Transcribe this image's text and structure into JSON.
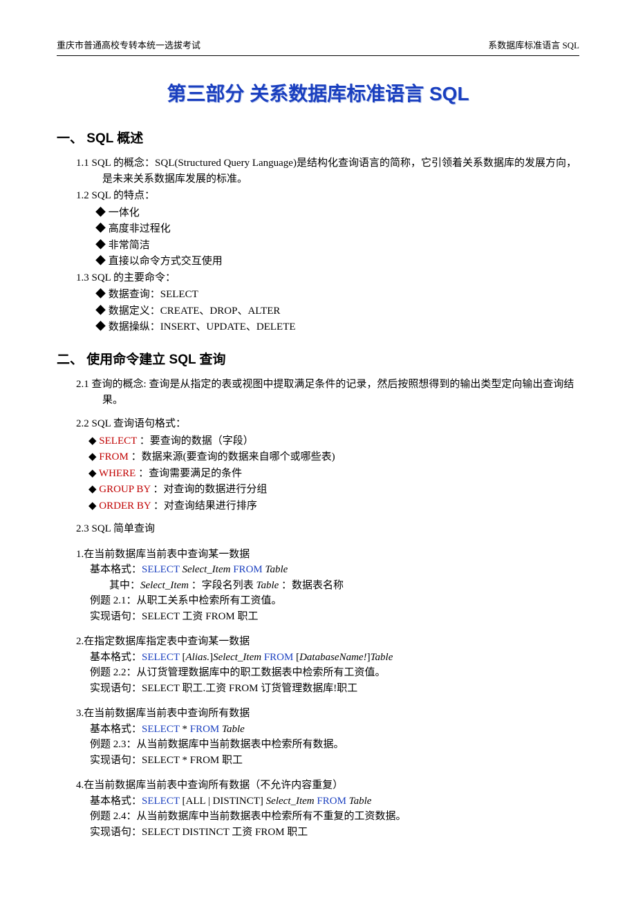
{
  "header": {
    "left": "重庆市普通高校专转本统一选拔考试",
    "right": "系数据库标准语言 SQL"
  },
  "title": "第三部分  关系数据库标准语言 SQL",
  "s1": {
    "heading": "一、 SQL 概述",
    "i1": {
      "num": "1.1",
      "text": " SQL 的概念：SQL(Structured Query Language)是结构化查询语言的简称，它引领着关系数据库的发展方向，是未来关系数据库发展的标准。"
    },
    "i2": {
      "num": "1.2",
      "text": " SQL 的特点：",
      "b": [
        "一体化",
        "高度非过程化",
        "非常简洁",
        "直接以命令方式交互使用"
      ]
    },
    "i3": {
      "num": "1.3",
      "text": " SQL 的主要命令：",
      "b": [
        "数据查询：SELECT",
        "数据定义：CREATE、DROP、ALTER",
        "数据操纵：INSERT、UPDATE、DELETE"
      ]
    }
  },
  "s2": {
    "heading": "二、 使用命令建立 SQL 查询",
    "i1": {
      "num": "2.1",
      "text": " 查询的概念: 查询是从指定的表或视图中提取满足条件的记录，然后按照想得到的输出类型定向输出查询结果。"
    },
    "i2": {
      "num": "2.2",
      "text": " SQL 查询语句格式：",
      "rows": [
        {
          "kw": "SELECT",
          "rest": " ：要查询的数据（字段）"
        },
        {
          "kw": "FROM",
          "rest": " ：数据来源(要查询的数据来自哪个或哪些表)"
        },
        {
          "kw": "WHERE",
          "rest": " ：查询需要满足的条件"
        },
        {
          "kw": "GROUP BY",
          "rest": " ：对查询的数据进行分组"
        },
        {
          "kw": "ORDER BY",
          "rest": " ：对查询结果进行排序"
        }
      ]
    },
    "i3": {
      "num": "2.3",
      "text": " SQL 简单查询",
      "q1": {
        "n": "1.在当前数据库当前表中查询某一数据",
        "fmt_lbl": "基本格式：",
        "fmt_sel": "SELECT",
        "fmt_it1": "Select_Item",
        "fmt_from": "FROM",
        "fmt_it2": "Table",
        "where": "其中：",
        "where_it1": "Select_Item",
        "where_t1": " ：字段名列表   ",
        "where_it2": "Table",
        "where_t2": " ：数据表名称",
        "ex": "例题 2.1：从职工关系中检索所有工资值。",
        "impl": "实现语句：SELECT 工资 FROM 职工"
      },
      "q2": {
        "n": "2.在指定数据库指定表中查询某一数据",
        "fmt_lbl": "基本格式：",
        "fmt_sel": "SELECT",
        "fmt_br1": " [",
        "fmt_it1": "Alias.",
        "fmt_br1b": "]",
        "fmt_it2": "Select_Item",
        "fmt_from": "FROM",
        "fmt_br2": " [",
        "fmt_it3": "DatabaseName!",
        "fmt_br2b": "]",
        "fmt_it4": "Table",
        "ex": "例题 2.2：从订货管理数据库中的职工数据表中检索所有工资值。",
        "impl": "实现语句：SELECT 职工.工资 FROM 订货管理数据库!职工"
      },
      "q3": {
        "n": "3.在当前数据库当前表中查询所有数据",
        "fmt_lbl": "基本格式：",
        "fmt_sel": "SELECT",
        "fmt_star": " *  ",
        "fmt_from": "FROM",
        "fmt_it": "Table",
        "ex": "例题 2.3：从当前数据库中当前数据表中检索所有数据。",
        "impl": "实现语句：SELECT * FROM 职工"
      },
      "q4": {
        "n": "4.在当前数据库当前表中查询所有数据（不允许内容重复）",
        "fmt_lbl": "基本格式：",
        "fmt_sel": "SELECT",
        "fmt_opt": " [ALL | DISTINCT] ",
        "fmt_it1": "Select_Item",
        "fmt_from": "FROM",
        "fmt_it2": "Table",
        "ex": "例题 2.4：从当前数据库中当前数据表中检索所有不重复的工资数据。",
        "impl": "实现语句：SELECT DISTINCT 工资 FROM 职工"
      }
    }
  }
}
